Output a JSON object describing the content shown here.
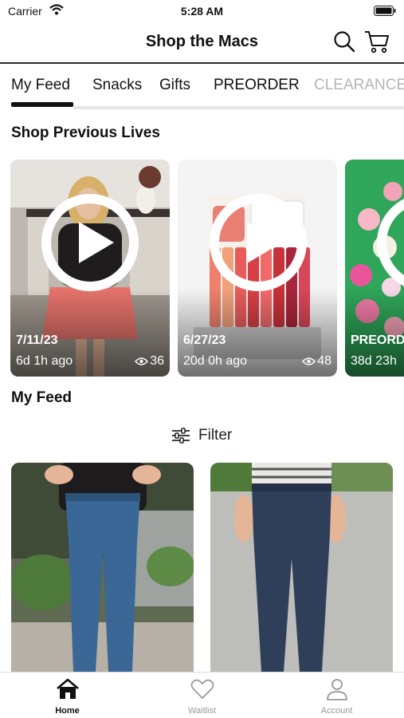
{
  "status_bar": {
    "carrier": "Carrier",
    "time": "5:28 AM"
  },
  "header": {
    "title": "Shop the Macs"
  },
  "tabs": [
    {
      "label": "My Feed"
    },
    {
      "label": "Snacks"
    },
    {
      "label": "Gifts"
    },
    {
      "label": "PREORDER"
    },
    {
      "label": "CLEARANCE"
    }
  ],
  "sections": {
    "previous_lives": "Shop Previous Lives",
    "my_feed": "My Feed"
  },
  "lives": [
    {
      "date": "7/11/23",
      "ago": "6d 1h ago",
      "views": "36"
    },
    {
      "date": "6/27/23",
      "ago": "20d 0h ago",
      "views": "48"
    },
    {
      "date": "PREORD",
      "ago": "38d 23h",
      "views": ""
    }
  ],
  "filter": {
    "label": "Filter"
  },
  "tabbar": [
    {
      "label": "Home",
      "icon": "home-icon"
    },
    {
      "label": "Waitlist",
      "icon": "heart-icon"
    },
    {
      "label": "Account",
      "icon": "person-icon"
    }
  ],
  "colors": {
    "accent": "#111111",
    "inactive": "#999999"
  }
}
